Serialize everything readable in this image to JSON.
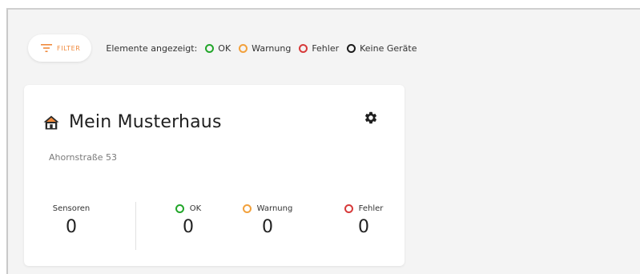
{
  "filter": {
    "label": "FILTER"
  },
  "legend": {
    "prefix": "Elemente angezeigt:",
    "items": [
      {
        "label": "OK",
        "color": "#22a62a"
      },
      {
        "label": "Warnung",
        "color": "#f2a13c"
      },
      {
        "label": "Fehler",
        "color": "#d73a3a"
      },
      {
        "label": "Keine Geräte",
        "color": "#1b1b1b"
      }
    ]
  },
  "card": {
    "title": "Mein Musterhaus",
    "address": "Ahornstraße 53",
    "icon": "home-icon",
    "settings_icon": "gear-icon",
    "stats": [
      {
        "label": "Sensoren",
        "value": "0"
      },
      {
        "label": "OK",
        "value": "0",
        "color": "#22a62a"
      },
      {
        "label": "Warnung",
        "value": "0",
        "color": "#f2a13c"
      },
      {
        "label": "Fehler",
        "value": "0",
        "color": "#d73a3a"
      }
    ]
  },
  "colors": {
    "accent": "#f08a3c",
    "background": "#f4f4f4",
    "card": "#ffffff"
  }
}
